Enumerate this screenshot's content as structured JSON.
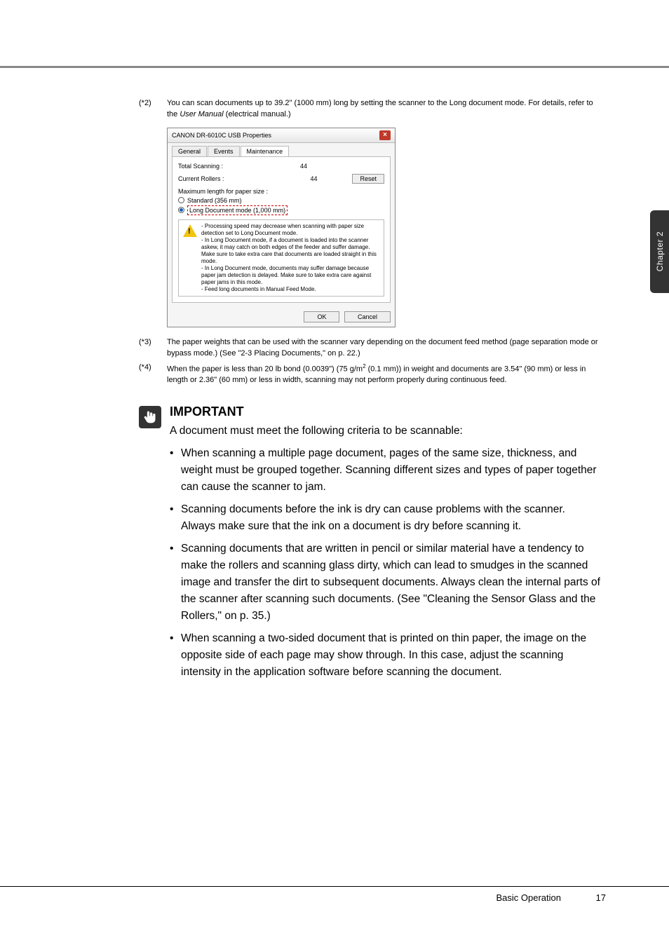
{
  "sideTab": "Chapter 2",
  "notes": {
    "n2": {
      "key": "(*2)",
      "text_a": "You can scan documents up to 39.2\" (1000 mm) long by setting the scanner to the Long document mode. For details, refer to the ",
      "em": "User Manual",
      "text_b": " (electrical manual.)"
    },
    "n3": {
      "key": "(*3)",
      "text": "The paper weights that can be used with the scanner vary depending on the document feed method (page separation mode or bypass mode.) (See \"2-3 Placing Documents,\" on p. 22.)"
    },
    "n4": {
      "key": "(*4)",
      "pre": "When the paper is less than 20 lb bond (0.0039\") (75 g/m",
      "sup": "2",
      "post": " (0.1 mm)) in weight and documents are 3.54\" (90 mm) or less in length or 2.36\" (60 mm) or less in width, scanning may not perform properly during continuous feed."
    }
  },
  "screenshot": {
    "title": "CANON DR-6010C USB Properties",
    "tabs": {
      "general": "General",
      "events": "Events",
      "maintenance": "Maintenance"
    },
    "rows": {
      "total": {
        "label": "Total Scanning :",
        "value": "44"
      },
      "rollers": {
        "label": "Current Rollers :",
        "value": "44"
      }
    },
    "reset": "Reset",
    "maxlen": "Maximum length for paper size :",
    "std": "Standard (356 mm)",
    "long": "Long Document mode (1,000 mm)",
    "warn": "- Processing speed may decrease when scanning with paper size detection set to Long Document mode.\n- In Long Document mode, if a document is loaded into the scanner askew, it may catch on both edges of the feeder and suffer damage. Make sure to take extra care that documents are loaded straight in this mode.\n- In Long Document mode, documents may suffer damage because paper jam detection is delayed. Make sure to take extra care against paper jams in this mode.\n- Feed long documents in Manual Feed Mode.",
    "ok": "OK",
    "cancel": "Cancel"
  },
  "important": {
    "heading": "IMPORTANT",
    "lead": "A document must meet the following criteria to be scannable:",
    "bullets": [
      "When scanning a multiple page document, pages of the same size, thickness, and weight must be grouped together. Scanning different sizes and types of paper together can cause the scanner to jam.",
      "Scanning documents before the ink is dry can cause problems with the scanner. Always make sure that the ink on a document is dry before scanning it.",
      "Scanning documents that are written in pencil or similar material have a tendency to make the rollers and scanning glass dirty, which can lead to smudges in the scanned image and transfer the dirt to subsequent documents. Always clean the internal parts of the scanner after scanning such documents. (See \"Cleaning the Sensor Glass and the Rollers,\" on p. 35.)",
      "When scanning a two-sided document that is printed on thin paper, the image on the opposite side of each page may show through. In this case, adjust the scanning intensity in the application software before scanning the document."
    ]
  },
  "footer": {
    "section": "Basic Operation",
    "page": "17"
  }
}
